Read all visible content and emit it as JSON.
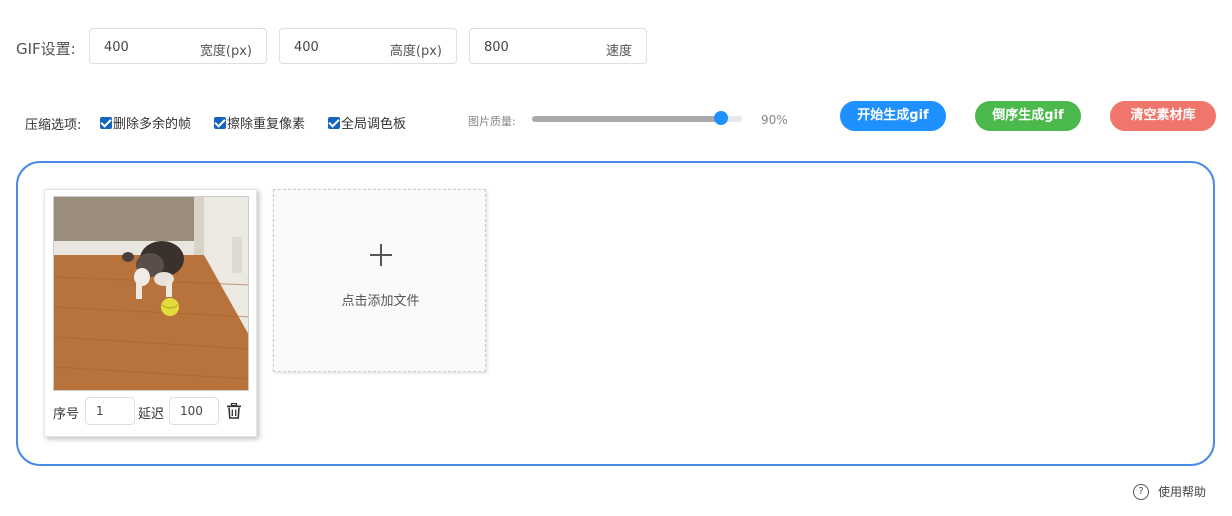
{
  "settings": {
    "label": "GIF设置:",
    "width": {
      "value": "400",
      "unit": "宽度(px)"
    },
    "height": {
      "value": "400",
      "unit": "高度(px)"
    },
    "speed": {
      "value": "800",
      "unit": "速度"
    }
  },
  "compress": {
    "label": "压缩选项:",
    "options": [
      {
        "label": "删除多余的帧",
        "checked": true
      },
      {
        "label": "擦除重复像素",
        "checked": true
      },
      {
        "label": "全局调色板",
        "checked": true
      }
    ]
  },
  "quality": {
    "label": "图片质量:",
    "value_text": "90%",
    "value": 0.9
  },
  "actions": {
    "start": "开始生成gif",
    "reverse": "倒序生成gif",
    "clear": "清空素材库"
  },
  "frames": [
    {
      "index_label": "序号",
      "index": "1",
      "delay_label": "延迟",
      "delay": "100"
    }
  ],
  "add_file": {
    "label": "点击添加文件"
  },
  "help": {
    "label": "使用帮助"
  },
  "colors": {
    "accent": "#1e90ff",
    "reverse": "#4cb94c",
    "clear": "#f0756a",
    "drop_border": "#4b8be7"
  }
}
